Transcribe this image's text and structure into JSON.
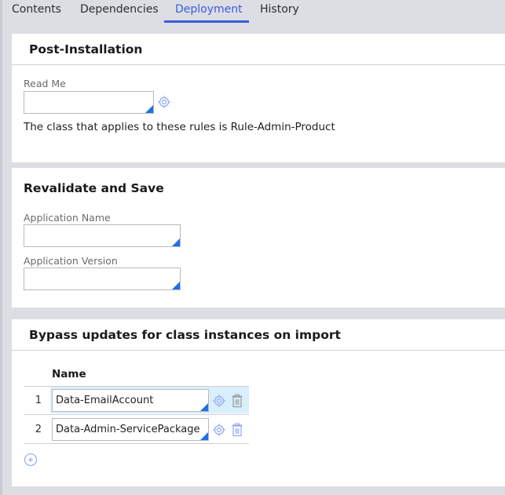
{
  "tabs": [
    {
      "label": "Contents",
      "active": false
    },
    {
      "label": "Dependencies",
      "active": false
    },
    {
      "label": "Deployment",
      "active": true
    },
    {
      "label": "History",
      "active": false
    }
  ],
  "post_installation": {
    "title": "Post-Installation",
    "read_me_label": "Read Me",
    "read_me_value": "",
    "info_text": "The class that applies to these rules is Rule-Admin-Product"
  },
  "revalidate": {
    "title": "Revalidate and Save",
    "app_name_label": "Application Name",
    "app_name_value": "",
    "app_version_label": "Application Version",
    "app_version_value": ""
  },
  "bypass": {
    "title": "Bypass updates for class instances on import",
    "column_header": "Name",
    "rows": [
      {
        "index": "1",
        "name": "Data-EmailAccount",
        "selected": true
      },
      {
        "index": "2",
        "name": "Data-Admin-ServicePackage",
        "selected": false
      }
    ]
  },
  "icons": {
    "target": "target-icon",
    "trash": "trash-icon",
    "add": "add-circle-icon",
    "autocomplete": "autocomplete-corner-icon"
  },
  "colors": {
    "accent": "#3b5be0",
    "corner_marker": "#1d6fe8",
    "selected_row": "#d9effc",
    "icon_blue": "#8fa6f0"
  }
}
